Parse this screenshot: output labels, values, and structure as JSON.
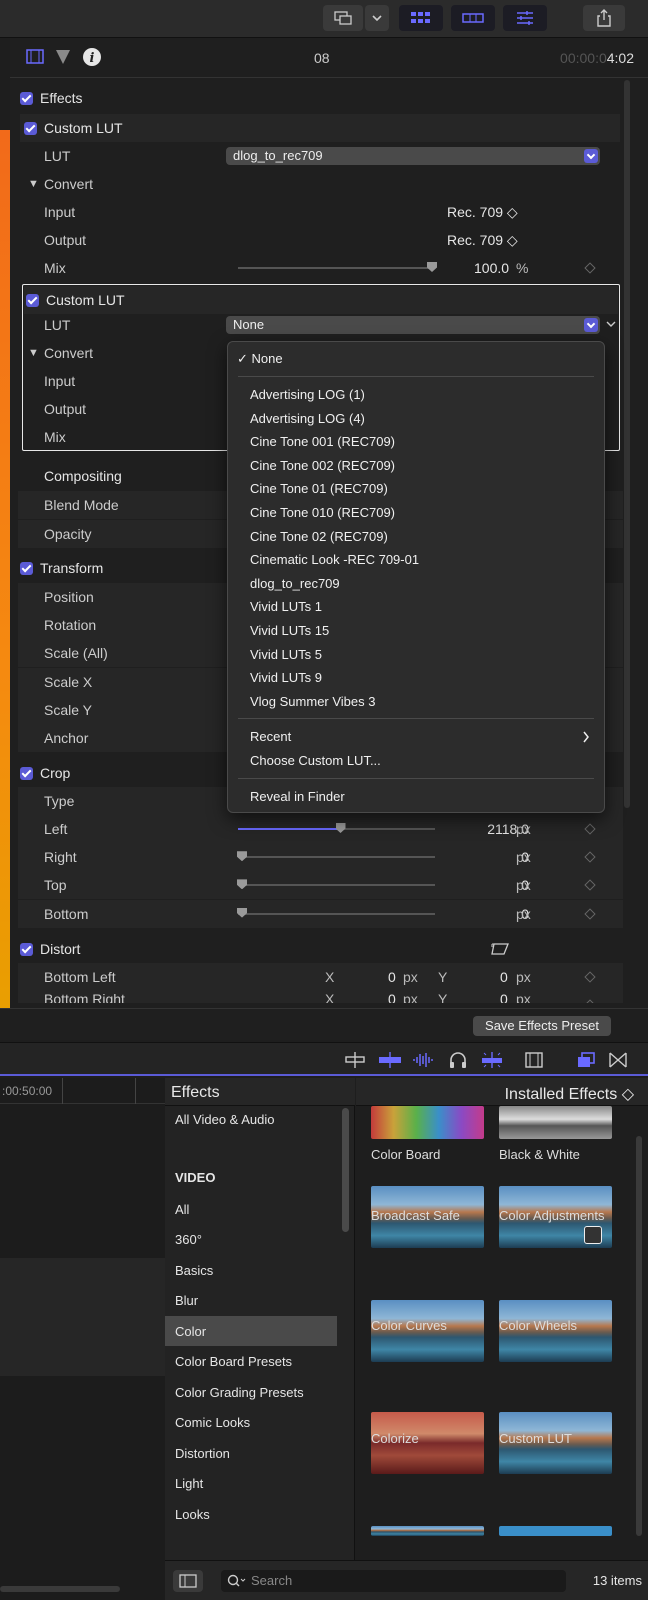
{
  "inspector": {
    "timecode_dim": "00:00:0",
    "timecode_bright": "4:02",
    "clip_number": "08",
    "effects_label": "Effects",
    "lut1": {
      "title": "Custom LUT",
      "lut_label": "LUT",
      "lut_value": "dlog_to_rec709",
      "convert_label": "Convert",
      "input_label": "Input",
      "input_value": "Rec. 709 ◇",
      "output_label": "Output",
      "output_value": "Rec. 709 ◇",
      "mix_label": "Mix",
      "mix_value": "100.0",
      "mix_unit": "%",
      "mix_fraction": 1.0
    },
    "lut2": {
      "title": "Custom LUT",
      "lut_label": "LUT",
      "lut_value": "None",
      "convert_label": "Convert",
      "input_label": "Input",
      "output_label": "Output",
      "mix_label": "Mix"
    },
    "compositing_label": "Compositing",
    "blend_mode_label": "Blend Mode",
    "opacity_label": "Opacity",
    "transform_label": "Transform",
    "transform_rows": [
      "Position",
      "Rotation",
      "Scale (All)",
      "Scale X",
      "Scale Y",
      "Anchor"
    ],
    "crop_label": "Crop",
    "crop_type_label": "Type",
    "crop_rows": [
      {
        "label": "Left",
        "value": "2118.0",
        "unit": "px",
        "fraction": 0.5
      },
      {
        "label": "Right",
        "value": "0",
        "unit": "px",
        "fraction": 0
      },
      {
        "label": "Top",
        "value": "0",
        "unit": "px",
        "fraction": 0
      },
      {
        "label": "Bottom",
        "value": "0",
        "unit": "px",
        "fraction": 0
      }
    ],
    "distort_label": "Distort",
    "distort_rows": [
      {
        "label": "Bottom Left",
        "x_label": "X",
        "x": "0",
        "y_label": "Y",
        "y": "0",
        "unit": "px"
      },
      {
        "label": "Bottom Right",
        "x_label": "X",
        "x": "0",
        "y_label": "Y",
        "y": "0",
        "unit": "px"
      }
    ],
    "save_preset": "Save Effects Preset"
  },
  "lut_menu": {
    "selected": "✓ None",
    "items": [
      "Advertising LOG (1)",
      "Advertising LOG (4)",
      "Cine Tone 001 (REC709)",
      "Cine Tone 002 (REC709)",
      "Cine Tone 01 (REC709)",
      "Cine Tone 010 (REC709)",
      "Cine Tone 02 (REC709)",
      "Cinematic Look -REC 709-01",
      "dlog_to_rec709",
      "Vivid LUTs 1",
      "Vivid LUTs 15",
      "Vivid LUTs 5",
      "Vivid LUTs 9",
      "Vlog Summer Vibes 3"
    ],
    "recent": "Recent",
    "choose": "Choose Custom LUT...",
    "reveal": "Reveal in Finder"
  },
  "timeline": {
    "ruler": ":00:50:00"
  },
  "browser": {
    "title": "Effects",
    "filter": "Installed Effects ◇",
    "categories": [
      "All Video & Audio",
      "VIDEO",
      "All",
      "360°",
      "Basics",
      "Blur",
      "Color",
      "Color Board Presets",
      "Color Grading Presets",
      "Comic Looks",
      "Distortion",
      "Light",
      "Looks"
    ],
    "selected_category": "Color",
    "effects": [
      "Color Board",
      "Black & White",
      "Broadcast Safe",
      "Color Adjustments",
      "Color Curves",
      "Color Wheels",
      "Colorize",
      "Custom LUT"
    ],
    "search_placeholder": "Search",
    "count": "13 items"
  },
  "colors": {
    "accent": "#5b5bd6",
    "menu_bg": "#2c2c2c"
  }
}
